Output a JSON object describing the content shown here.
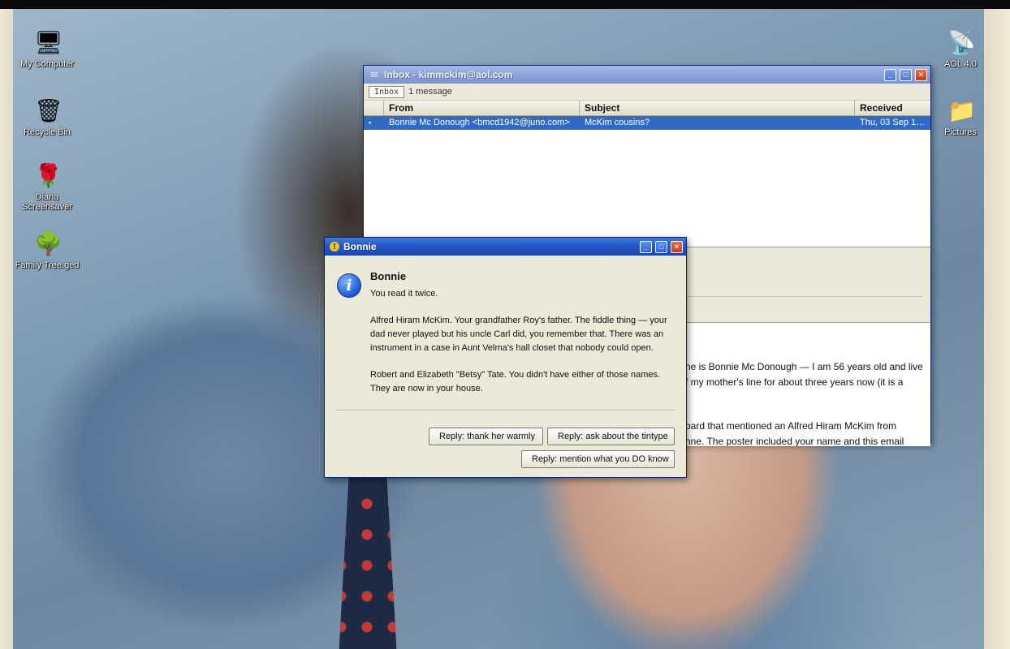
{
  "desktop": {
    "icons_left": [
      {
        "name": "my-computer",
        "label": "My Computer",
        "glyph": "🖥"
      },
      {
        "name": "recycle-bin",
        "label": "Recycle Bin",
        "glyph": "🗑"
      },
      {
        "name": "diana-screensaver",
        "label": "Diana Screensaver",
        "glyph": "🌹"
      },
      {
        "name": "family-tree",
        "label": "Family Tree.ged",
        "glyph": "🌳"
      }
    ],
    "icons_right": [
      {
        "name": "aol",
        "label": "AOL 4.0",
        "glyph": "📡"
      },
      {
        "name": "pictures",
        "label": "Pictures",
        "glyph": "📁"
      }
    ]
  },
  "inbox": {
    "title": "Inbox - kimmckim@aol.com",
    "folder": "Inbox",
    "count": "1 message",
    "columns": [
      "From",
      "Subject",
      "Received"
    ],
    "messages": [
      {
        "from": "Bonnie Mc Donough <bmcd1942@juno.com>",
        "subject": "McKim cousins?",
        "received": "Thu, 03 Sep 1…"
      }
    ],
    "body_lines": [
      "ne is Bonnie Mc Donough — I am 56 years old and live",
      "f my mother's line for about three years now (it is a",
      "oard that mentioned an Alfred Hiram McKim from",
      "nne. The poster included your name and this email"
    ]
  },
  "dialog": {
    "title": "Bonnie",
    "heading": "Bonnie",
    "paragraphs": [
      "You read it twice.",
      "Alfred Hiram McKim. Your grandfather Roy's father. The fiddle thing — your dad never played but his uncle Carl did, you remember that. There was an instrument in a case in Aunt Velma's hall closet that nobody could open.",
      "Robert and Elizabeth \"Betsy\" Tate. You didn't have either of those names. They are now in your house."
    ],
    "buttons": {
      "warm": "Reply: thank her warmly",
      "tintype": "Reply: ask about the tintype",
      "know": "Reply: mention what you DO know"
    }
  },
  "colors": {
    "titlebar": "#2458c8",
    "selection": "#316ac5",
    "dialog_bg": "#ece9d8"
  }
}
